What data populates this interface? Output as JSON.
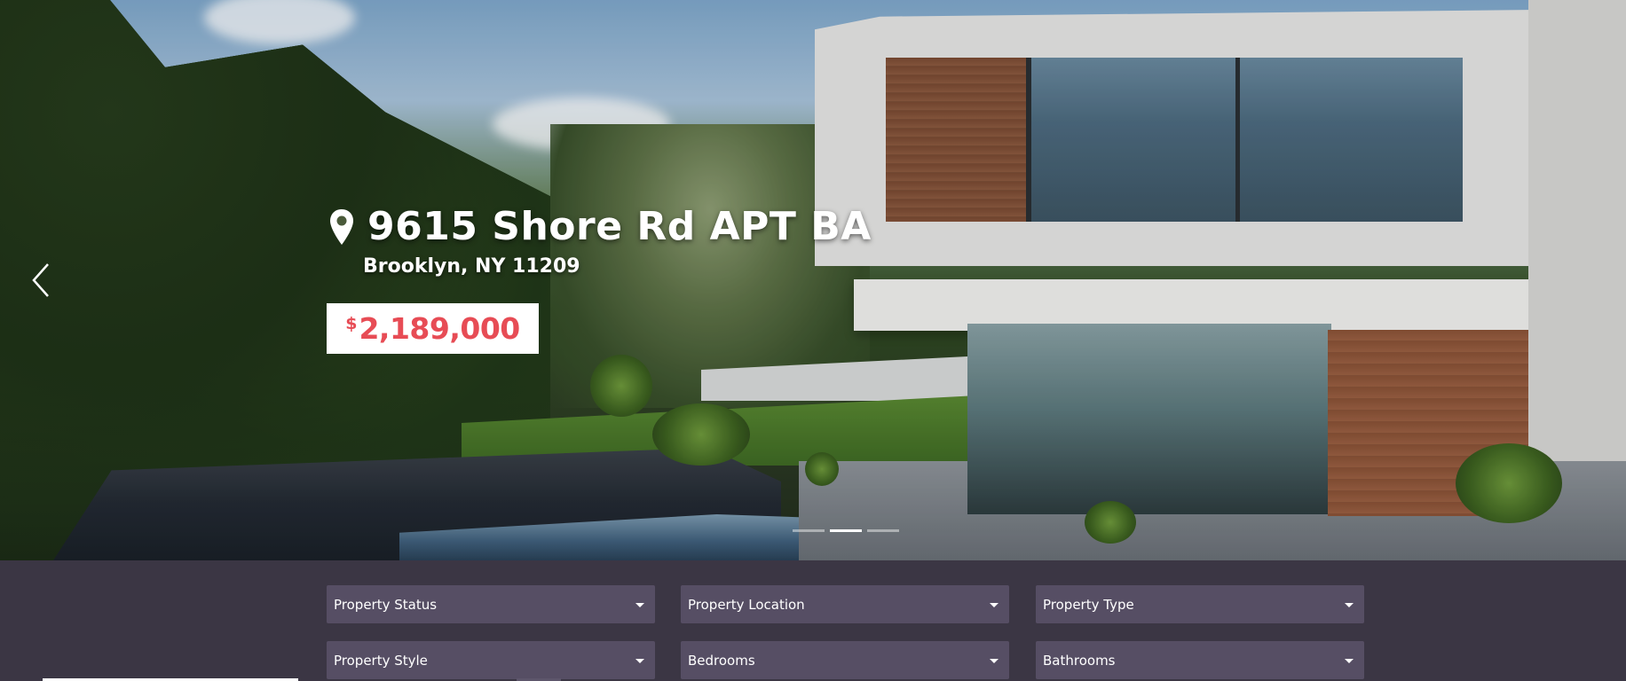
{
  "hero": {
    "address": "9615 Shore Rd APT BA",
    "city": "Brooklyn, NY 11209",
    "price_currency": "$",
    "price_amount": "2,189,000",
    "slide_count": 3,
    "active_slide": 2
  },
  "search": {
    "fields": [
      {
        "label": "Property Status"
      },
      {
        "label": "Property Location"
      },
      {
        "label": "Property Type"
      },
      {
        "label": "Property Style"
      },
      {
        "label": "Bedrooms"
      },
      {
        "label": "Bathrooms"
      }
    ]
  },
  "colors": {
    "price": "#e74c55",
    "panel_bg": "#3b3644",
    "select_bg": "#564e64"
  },
  "icons": {
    "address": "map-pin-icon",
    "prev": "chevron-left-icon",
    "select": "caret-down-icon"
  }
}
